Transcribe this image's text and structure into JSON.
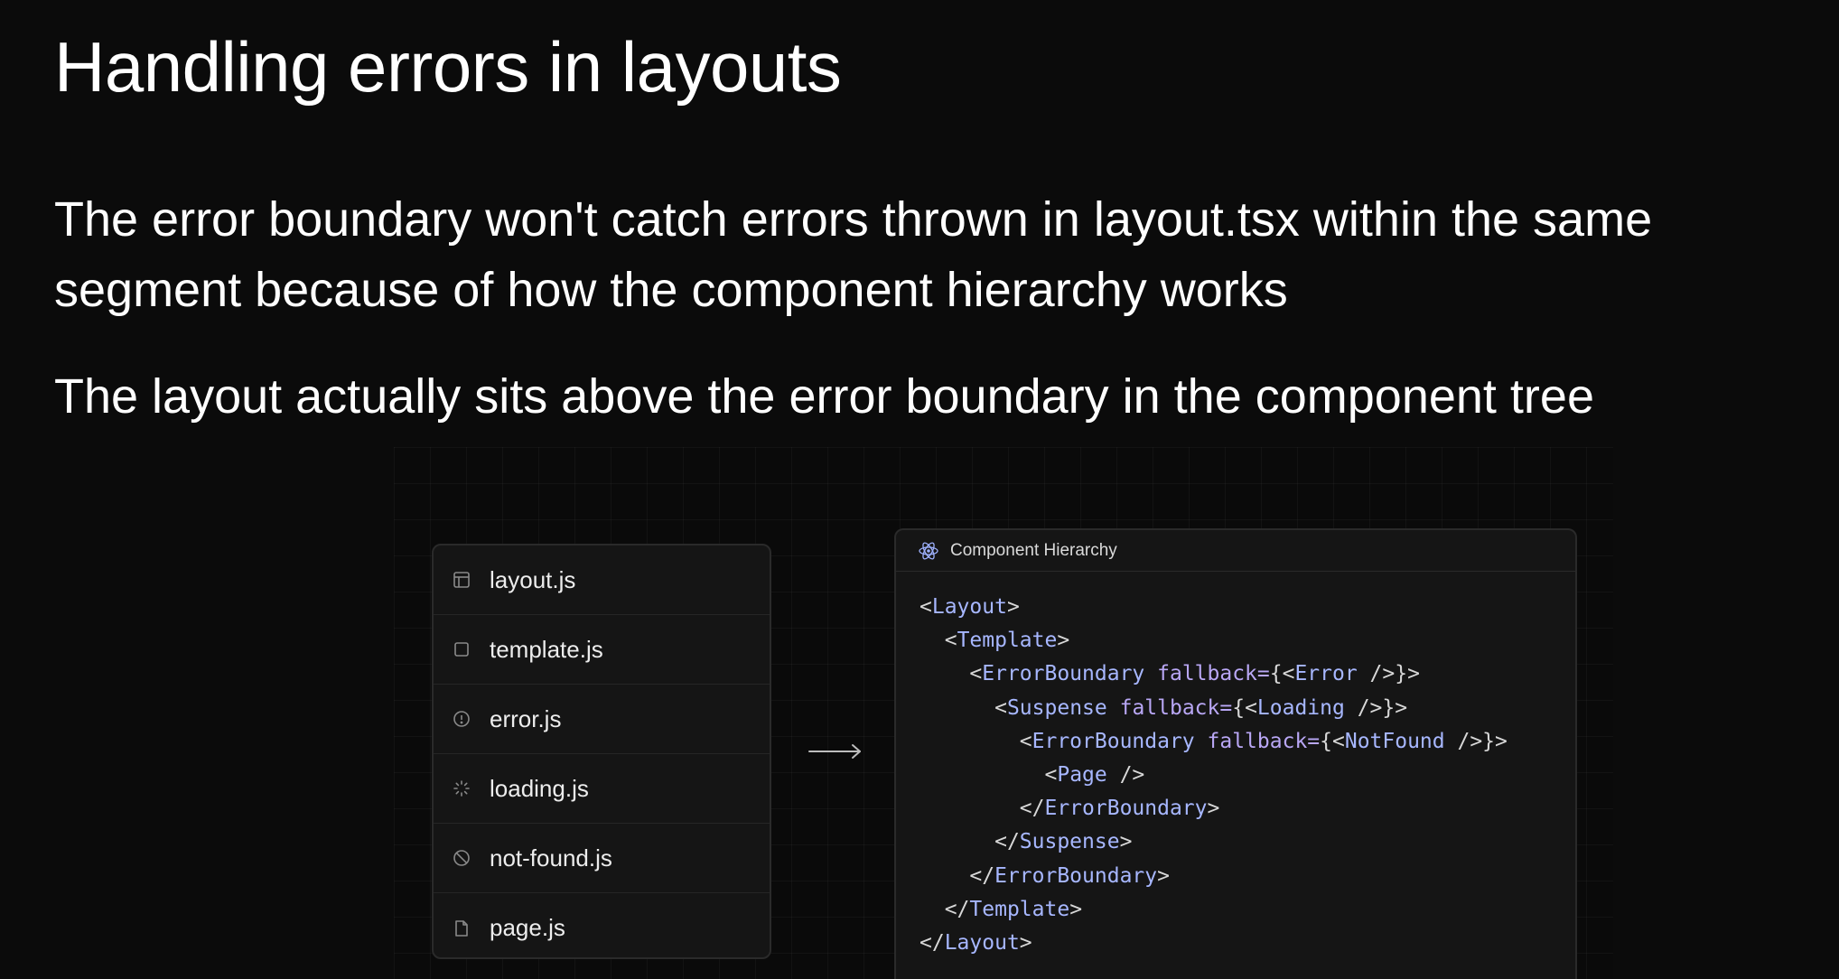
{
  "slide": {
    "title": "Handling errors in layouts",
    "paragraph_1": "The error boundary won't catch errors thrown in layout.tsx within the same segment because of how the component hierarchy works",
    "paragraph_2": "The layout actually sits above the error boundary in the component tree"
  },
  "files": [
    {
      "label": "layout.js",
      "icon": "layout-icon"
    },
    {
      "label": "template.js",
      "icon": "square-icon"
    },
    {
      "label": "error.js",
      "icon": "alert-circle-icon"
    },
    {
      "label": "loading.js",
      "icon": "loader-icon"
    },
    {
      "label": "not-found.js",
      "icon": "ban-icon"
    },
    {
      "label": "page.js",
      "icon": "file-icon"
    }
  ],
  "hierarchy": {
    "title": "Component Hierarchy",
    "icon": "react-icon",
    "code_lines": [
      {
        "indent": 0,
        "parts": [
          {
            "t": "punct",
            "v": "<"
          },
          {
            "t": "tag",
            "v": "Layout"
          },
          {
            "t": "punct",
            "v": ">"
          }
        ]
      },
      {
        "indent": 1,
        "parts": [
          {
            "t": "punct",
            "v": "<"
          },
          {
            "t": "tag",
            "v": "Template"
          },
          {
            "t": "punct",
            "v": ">"
          }
        ]
      },
      {
        "indent": 2,
        "parts": [
          {
            "t": "punct",
            "v": "<"
          },
          {
            "t": "tag",
            "v": "ErrorBoundary"
          },
          {
            "t": "punct",
            "v": " "
          },
          {
            "t": "attr",
            "v": "fallback="
          },
          {
            "t": "punct",
            "v": "{<"
          },
          {
            "t": "tag",
            "v": "Error"
          },
          {
            "t": "punct",
            "v": " />}>"
          }
        ]
      },
      {
        "indent": 3,
        "parts": [
          {
            "t": "punct",
            "v": "<"
          },
          {
            "t": "tag",
            "v": "Suspense"
          },
          {
            "t": "punct",
            "v": " "
          },
          {
            "t": "attr",
            "v": "fallback="
          },
          {
            "t": "punct",
            "v": "{<"
          },
          {
            "t": "tag",
            "v": "Loading"
          },
          {
            "t": "punct",
            "v": " />}>"
          }
        ]
      },
      {
        "indent": 4,
        "parts": [
          {
            "t": "punct",
            "v": "<"
          },
          {
            "t": "tag",
            "v": "ErrorBoundary"
          },
          {
            "t": "punct",
            "v": " "
          },
          {
            "t": "attr",
            "v": "fallback="
          },
          {
            "t": "punct",
            "v": "{<"
          },
          {
            "t": "tag",
            "v": "NotFound"
          },
          {
            "t": "punct",
            "v": " />}>"
          }
        ]
      },
      {
        "indent": 5,
        "parts": [
          {
            "t": "punct",
            "v": "<"
          },
          {
            "t": "tag",
            "v": "Page"
          },
          {
            "t": "punct",
            "v": " />"
          }
        ]
      },
      {
        "indent": 4,
        "parts": [
          {
            "t": "punct",
            "v": "</"
          },
          {
            "t": "tag",
            "v": "ErrorBoundary"
          },
          {
            "t": "punct",
            "v": ">"
          }
        ]
      },
      {
        "indent": 3,
        "parts": [
          {
            "t": "punct",
            "v": "</"
          },
          {
            "t": "tag",
            "v": "Suspense"
          },
          {
            "t": "punct",
            "v": ">"
          }
        ]
      },
      {
        "indent": 2,
        "parts": [
          {
            "t": "punct",
            "v": "</"
          },
          {
            "t": "tag",
            "v": "ErrorBoundary"
          },
          {
            "t": "punct",
            "v": ">"
          }
        ]
      },
      {
        "indent": 1,
        "parts": [
          {
            "t": "punct",
            "v": "</"
          },
          {
            "t": "tag",
            "v": "Template"
          },
          {
            "t": "punct",
            "v": ">"
          }
        ]
      },
      {
        "indent": 0,
        "parts": [
          {
            "t": "punct",
            "v": "</"
          },
          {
            "t": "tag",
            "v": "Layout"
          },
          {
            "t": "punct",
            "v": ">"
          }
        ]
      }
    ]
  },
  "colors": {
    "background": "#0b0b0b",
    "panel": "#151515",
    "tag": "#a7b7ff",
    "attr": "#b9a7f5"
  }
}
